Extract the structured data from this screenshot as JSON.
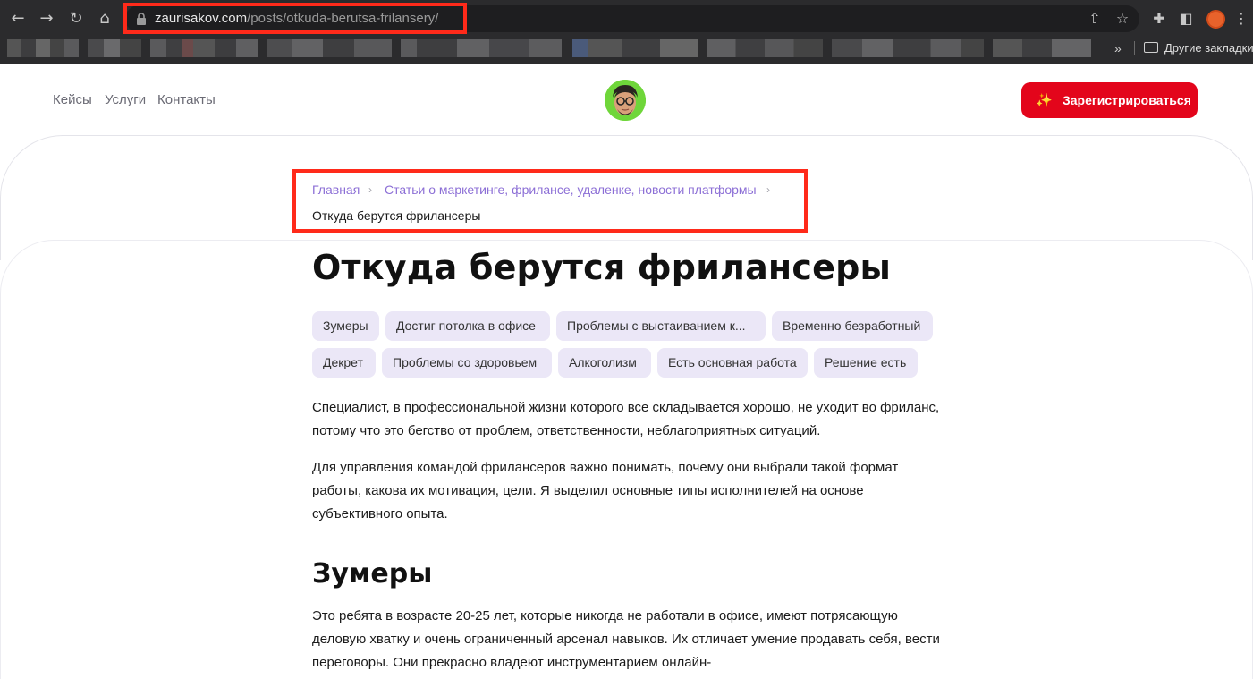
{
  "browser": {
    "url_host": "zaurisakov.com",
    "url_path": "/posts/otkuda-berutsa-frilansery/",
    "bookmarks_overflow": "»",
    "bookmarks_folder": "Другие закладки"
  },
  "header": {
    "nav": [
      "Кейсы",
      "Услуги",
      "Контакты"
    ],
    "register_label": "Зарегистрироваться"
  },
  "breadcrumb": {
    "home": "Главная",
    "section": "Статьи о маркетинге, фрилансе, удаленке, новости платформы",
    "separator": "›",
    "current": "Откуда берутся фрилансеры"
  },
  "article": {
    "title": "Откуда берутся фрилансеры",
    "tags": [
      "Зумеры",
      "Достиг потолка в офисе",
      "Проблемы с выстаиванием к...",
      "Временно безработный",
      "Декрет",
      "Проблемы со здоровьем",
      "Алкоголизм",
      "Есть основная работа",
      "Решение есть"
    ],
    "paragraphs": [
      "Специалист, в профессиональной жизни которого все складывается хорошо, не уходит во фриланс, потому что это бегство от проблем, ответственности, неблагоприятных ситуаций.",
      "Для управления командой фрилансеров важно понимать, почему они выбрали такой формат работы, какова их мотивация, цели. Я выделил основные типы исполнителей на основе субъективного опыта."
    ],
    "section_heading": "Зумеры",
    "section_paragraph": "Это ребята в возрасте 20-25 лет, которые никогда не работали в офисе, имеют потрясающую деловую хватку и очень ограниченный арсенал навыков. Их отличает умение продавать себя, вести переговоры. Они прекрасно владеют инструментарием онлайн-"
  },
  "colors": {
    "accent_red": "#e3051b",
    "link_purple": "#8c6fd6",
    "tag_bg": "#ebe7f7",
    "annotation_red": "#ff2a1a"
  }
}
